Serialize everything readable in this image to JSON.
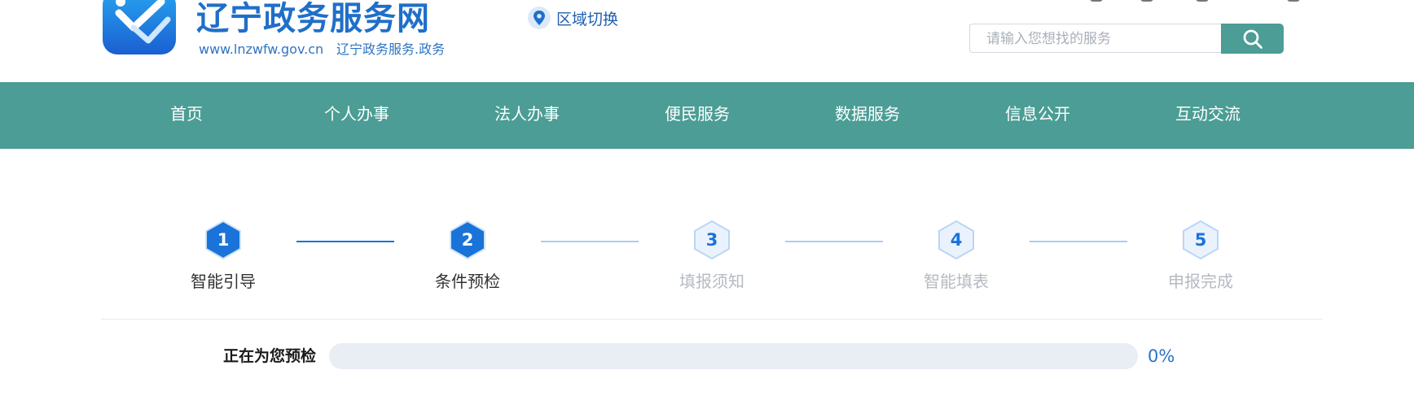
{
  "header": {
    "site_name": "辽宁政务服务网",
    "domain": "www.lnzwfw.gov.cn",
    "slogan": "辽宁政务服务.政务",
    "region_switch": "区域切换",
    "logo_icon": "logo-icon",
    "location_icon": "location-pin-icon"
  },
  "search": {
    "placeholder": "请输入您想找的服务",
    "value": "",
    "button_icon": "search-icon"
  },
  "nav": {
    "items": [
      {
        "label": "首页"
      },
      {
        "label": "个人办事"
      },
      {
        "label": "法人办事"
      },
      {
        "label": "便民服务"
      },
      {
        "label": "数据服务"
      },
      {
        "label": "信息公开"
      },
      {
        "label": "互动交流"
      }
    ]
  },
  "steps": [
    {
      "number": "1",
      "label": "智能引导",
      "state": "done"
    },
    {
      "number": "2",
      "label": "条件预检",
      "state": "active"
    },
    {
      "number": "3",
      "label": "填报须知",
      "state": "todo"
    },
    {
      "number": "4",
      "label": "智能填表",
      "state": "todo"
    },
    {
      "number": "5",
      "label": "申报完成",
      "state": "todo"
    }
  ],
  "progress": {
    "label": "正在为您预检",
    "percent_text": "0%",
    "percent": 0
  },
  "colors": {
    "brand_blue": "#1f6fc9",
    "nav_teal": "#4b9d95",
    "step_active": "#1a73d9",
    "step_inactive_fill": "#eaf3fd",
    "step_inactive_border": "#b9d6f5",
    "connector_done": "#1a73d9",
    "connector_todo": "#a9cdf3"
  }
}
